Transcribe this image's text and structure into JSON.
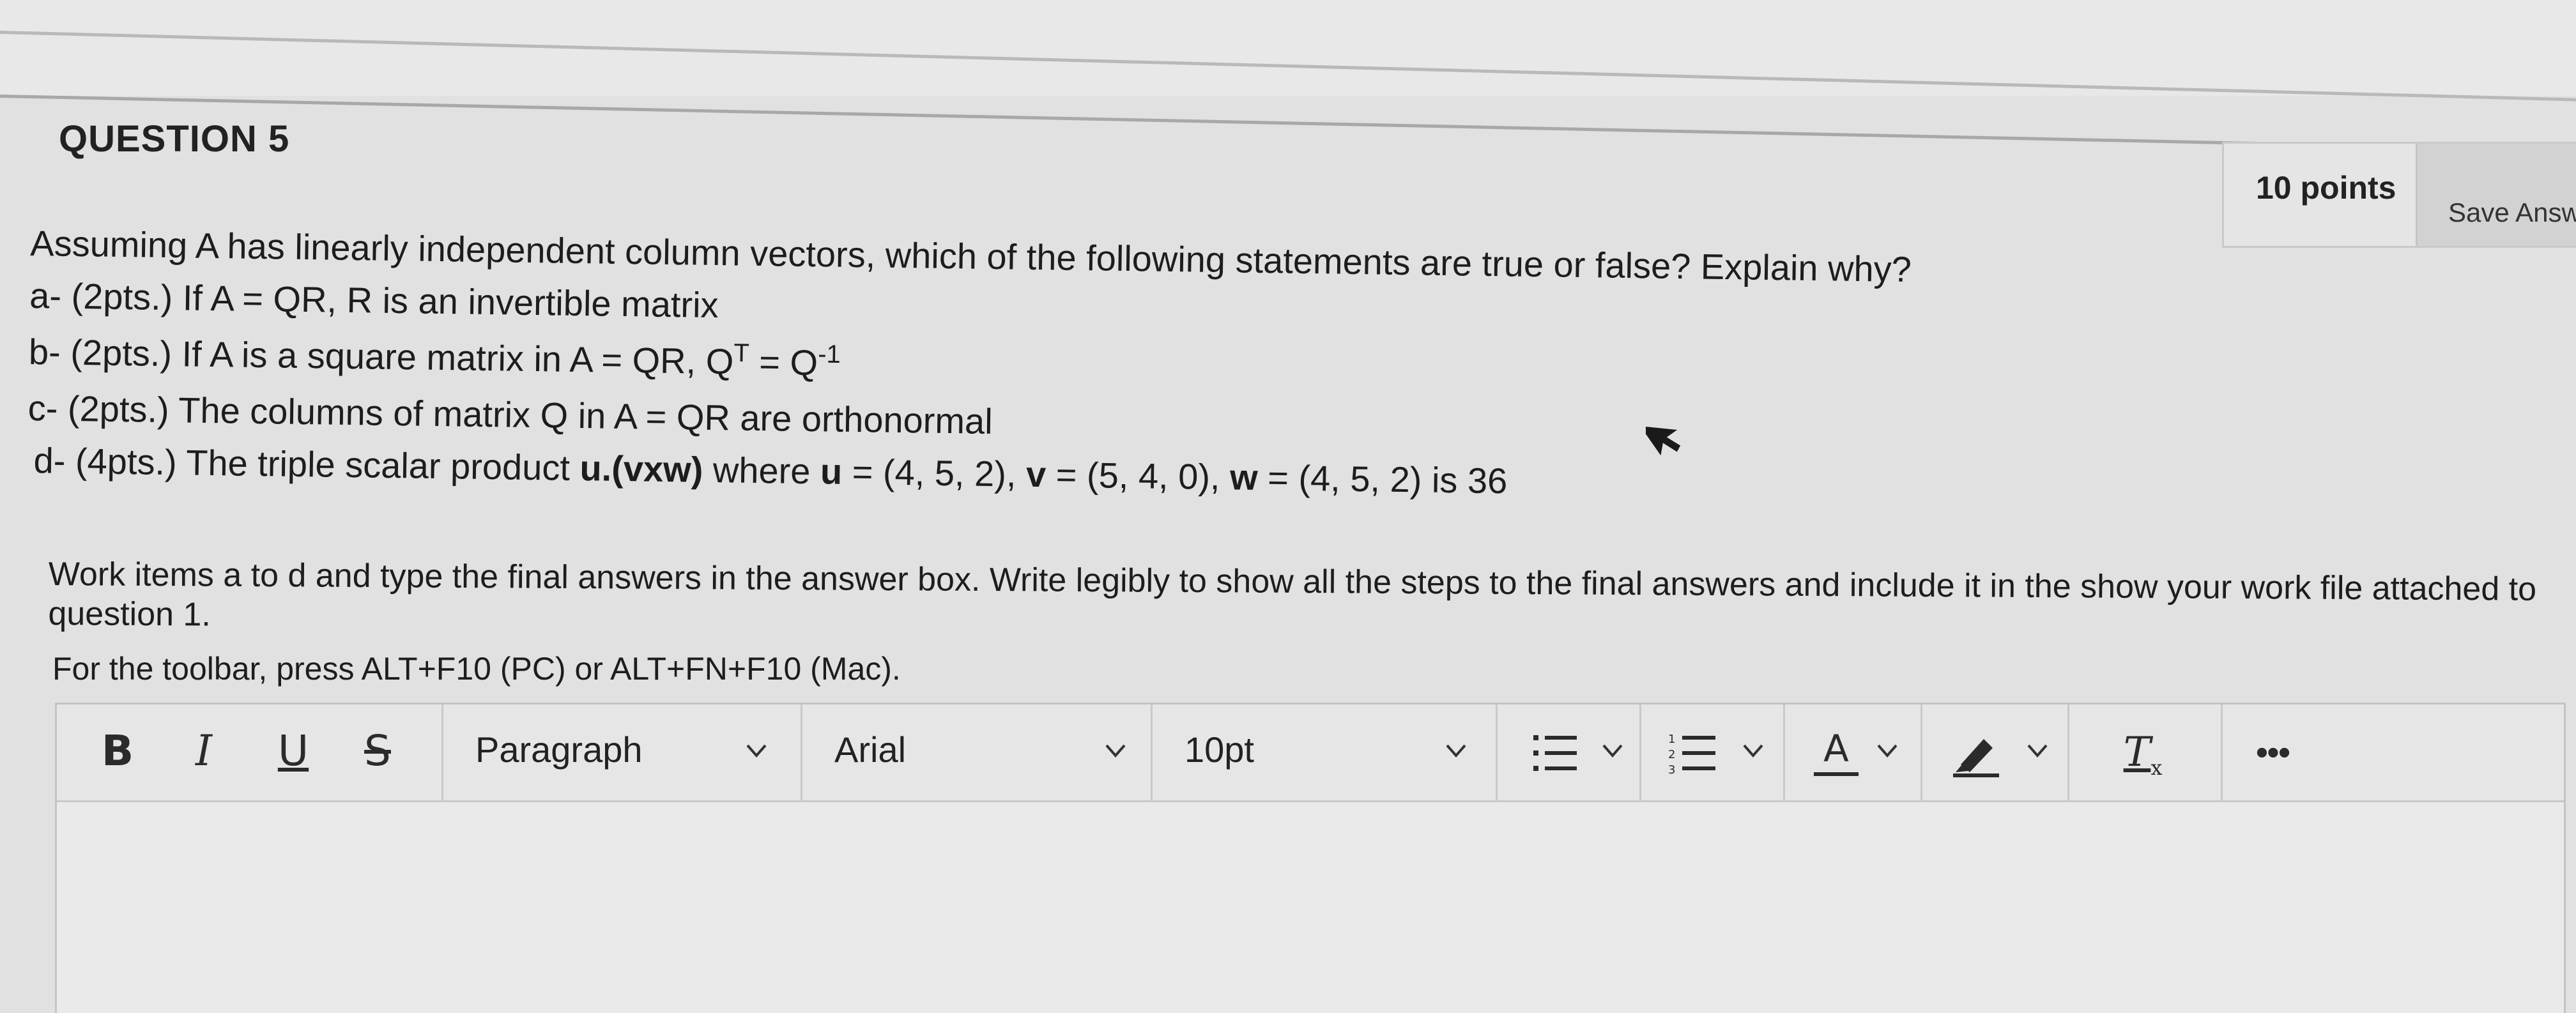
{
  "question": {
    "title": "QUESTION 5",
    "points": "10 points",
    "save_label": "Save Answ",
    "prompt": "Assuming A has linearly independent column vectors, which of the following statements are true or false? Explain why?",
    "items": {
      "a": "a- (2pts.)  If A = QR, R is an invertible matrix",
      "b_pre": "b- (2pts.) If A is a square matrix in A = QR, Q",
      "b_sup1": "T",
      "b_mid": " = Q",
      "b_sup2": "-1",
      "c": "c- (2pts.) The columns of matrix Q in A = QR are orthonormal",
      "d_1": "d- (4pts.) The triple scalar product ",
      "d_u_vxw": "u.(vxw)",
      "d_2": " where ",
      "d_u": "u",
      "d_3": " = (4, 5, 2), ",
      "d_v": "v",
      "d_4": " = (5, 4, 0), ",
      "d_w": "w",
      "d_5": " = (4, 5, 2) is 36"
    }
  },
  "instructions": "Work items a to d and type the final answers in the answer box.  Write legibly to show all the steps to the final answers and include it in the show your work file attached to question 1.",
  "toolbar_hint": "For the toolbar, press ALT+F10 (PC) or ALT+FN+F10 (Mac).",
  "editor": {
    "bold": "B",
    "italic": "I",
    "underline": "U",
    "strike": "S",
    "paragraph_value": "Paragraph",
    "font_value": "Arial",
    "size_value": "10pt",
    "font_color_letter": "A",
    "clear_format_letter": "T",
    "clear_format_sub": "x",
    "more": "•••",
    "text_area_value": ""
  },
  "icons": [
    "chevron-down-icon",
    "bullet-list-icon",
    "numbered-list-icon",
    "font-color-icon",
    "highlight-icon",
    "clear-format-icon",
    "more-icon",
    "mouse-pointer-icon"
  ]
}
